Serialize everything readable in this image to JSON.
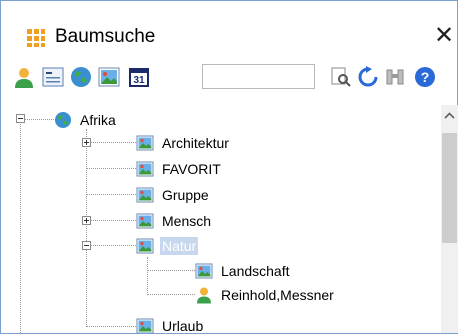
{
  "window": {
    "title": "Baumsuche",
    "close_glyph": "✕"
  },
  "toolbar": {
    "buttons": [
      {
        "icon": "person-icon"
      },
      {
        "icon": "text-field-icon"
      },
      {
        "icon": "globe-icon"
      },
      {
        "icon": "image-icon"
      },
      {
        "icon": "calendar-icon",
        "label": "31"
      },
      {
        "icon": "find-icon"
      },
      {
        "icon": "refresh-icon"
      },
      {
        "icon": "binoculars-icon"
      },
      {
        "icon": "help-icon",
        "label": "?"
      }
    ],
    "search_value": ""
  },
  "tree": {
    "root": {
      "label": "Afrika",
      "icon": "globe-icon",
      "expanded": true
    },
    "children": [
      {
        "label": "Architektur",
        "icon": "image-icon",
        "expander": "plus"
      },
      {
        "label": "FAVORIT",
        "icon": "image-icon"
      },
      {
        "label": "Gruppe",
        "icon": "image-icon"
      },
      {
        "label": "Mensch",
        "icon": "image-icon",
        "expander": "plus"
      },
      {
        "label": "Natur",
        "icon": "image-icon",
        "expander": "minus",
        "selected": true,
        "children": [
          {
            "label": "Landschaft",
            "icon": "image-icon"
          },
          {
            "label": "Reinhold,Messner",
            "icon": "person-icon"
          }
        ]
      },
      {
        "label": "Urlaub",
        "icon": "image-icon"
      }
    ]
  },
  "colors": {
    "accent": "#f0a020",
    "selection": "#c7d7ee",
    "border": "#7a9fd0"
  }
}
